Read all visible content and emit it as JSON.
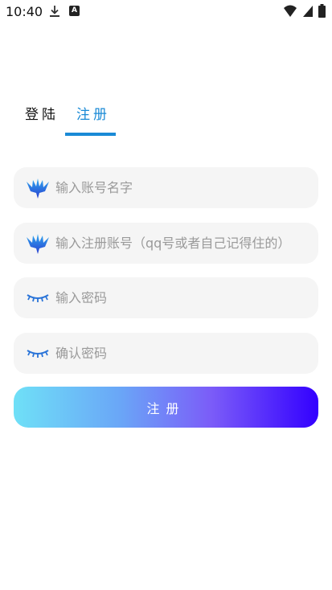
{
  "status_bar": {
    "time": "10:40",
    "icons": [
      "download-icon",
      "a-badge-icon",
      "wifi-icon",
      "signal-icon",
      "battery-icon"
    ]
  },
  "tabs": [
    {
      "label": "登陆",
      "active": false
    },
    {
      "label": "注册",
      "active": true
    }
  ],
  "form": {
    "name_placeholder": "输入账号名字",
    "account_placeholder": "输入注册账号（qq号或者自己记得住的）",
    "password_placeholder": "输入密码",
    "confirm_placeholder": "确认密码",
    "submit_label": "注册"
  },
  "colors": {
    "accent": "#1a8ad6",
    "field_bg": "#f5f5f5",
    "gradient_start": "#6fe0f7",
    "gradient_end": "#3300ff"
  }
}
